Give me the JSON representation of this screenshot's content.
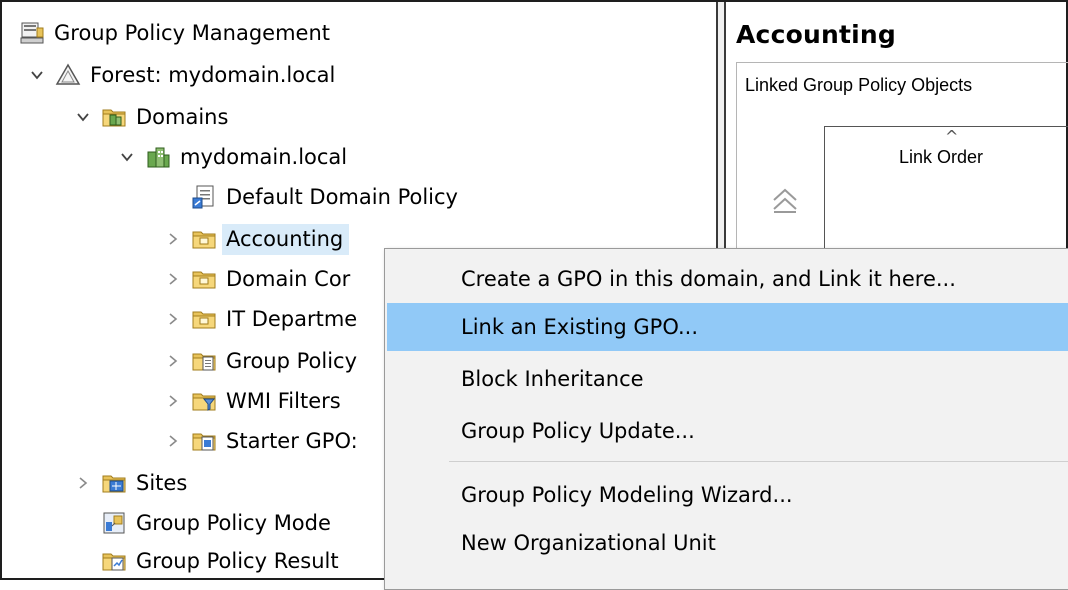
{
  "tree": {
    "items": [
      {
        "label": "Group Policy Management",
        "icon": "gpm-console-icon",
        "indent": 0,
        "arrow": "none"
      },
      {
        "label": "Forest: mydomain.local",
        "icon": "forest-icon",
        "indent": 1,
        "arrow": "expanded"
      },
      {
        "label": "Domains",
        "icon": "domains-folder-icon",
        "indent": 2,
        "arrow": "expanded"
      },
      {
        "label": "mydomain.local",
        "icon": "domain-icon",
        "indent": 3,
        "arrow": "expanded"
      },
      {
        "label": "Default Domain Policy",
        "icon": "gpo-link-icon",
        "indent": 4,
        "arrow": "none"
      },
      {
        "label": "Accounting",
        "icon": "ou-folder-icon",
        "indent": 4,
        "arrow": "collapsed",
        "selected": true
      },
      {
        "label": "Domain Cor",
        "icon": "ou-folder-icon",
        "indent": 4,
        "arrow": "collapsed"
      },
      {
        "label": "IT Departme",
        "icon": "ou-folder-icon",
        "indent": 4,
        "arrow": "collapsed"
      },
      {
        "label": "Group Policy",
        "icon": "gpo-folder-icon",
        "indent": 4,
        "arrow": "collapsed"
      },
      {
        "label": "WMI Filters",
        "icon": "wmi-folder-icon",
        "indent": 4,
        "arrow": "collapsed"
      },
      {
        "label": "Starter GPO:",
        "icon": "starter-gpo-folder-icon",
        "indent": 4,
        "arrow": "collapsed"
      },
      {
        "label": "Sites",
        "icon": "sites-folder-icon",
        "indent": 2,
        "arrow": "collapsed"
      },
      {
        "label": "Group Policy Mode",
        "icon": "modeling-icon",
        "indent": 2,
        "arrow": "none"
      },
      {
        "label": "Group Policy Result",
        "icon": "results-icon",
        "indent": 2,
        "arrow": "none"
      }
    ]
  },
  "details": {
    "title": "Accounting",
    "tab_label": "Linked Group Policy Objects",
    "column_header": "Link Order",
    "sort_indicator": "^"
  },
  "context_menu": {
    "items": [
      {
        "label": "Create a GPO in this domain, and Link it here...",
        "highlighted": false
      },
      {
        "label": "Link an Existing GPO...",
        "highlighted": true
      },
      {
        "label": "Block Inheritance",
        "highlighted": false
      },
      {
        "label": "Group Policy Update...",
        "highlighted": false
      },
      {
        "separator": true
      },
      {
        "label": "Group Policy Modeling Wizard...",
        "highlighted": false
      },
      {
        "label": "New Organizational Unit",
        "highlighted": false
      }
    ]
  },
  "colors": {
    "menu_highlight": "#91c9f7",
    "tree_selection": "#d9ebf9",
    "menu_background": "#f2f2f2"
  }
}
